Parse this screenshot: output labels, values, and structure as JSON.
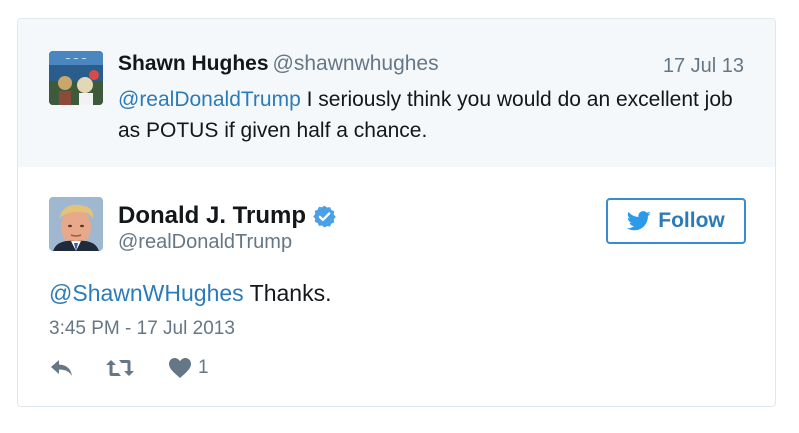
{
  "quoted_tweet": {
    "author_name": "Shawn Hughes",
    "author_handle": "@shawnwhughes",
    "date": "17 Jul 13",
    "mention": "@realDonaldTrump",
    "text": " I seriously think you would do an excellent job as POTUS if given half a chance."
  },
  "main_tweet": {
    "author_name": "Donald J. Trump",
    "author_handle": "@realDonaldTrump",
    "verified": true,
    "follow_label": "Follow",
    "mention": "@ShawnWHughes",
    "text": " Thanks.",
    "timestamp": "3:45 PM - 17 Jul 2013",
    "likes": "1"
  },
  "icons": {
    "verified": "verified-badge-icon",
    "follow": "twitter-bird-icon",
    "reply": "reply-icon",
    "retweet": "retweet-icon",
    "like": "heart-icon"
  },
  "colors": {
    "link": "#2b7bb9",
    "muted": "#657786",
    "text": "#14171a",
    "quoted_bg": "#f5f8fa",
    "border": "#e1e8ed"
  }
}
